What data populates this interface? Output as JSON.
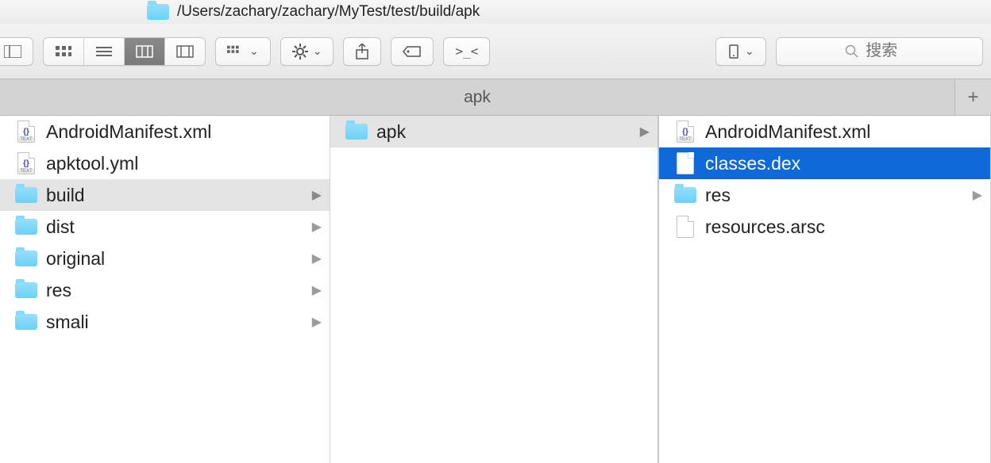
{
  "path": "/Users/zachary/zachary/MyTest/test/build/apk",
  "search": {
    "placeholder": "搜索"
  },
  "tab": {
    "label": "apk"
  },
  "columns": [
    {
      "items": [
        {
          "name": "AndroidManifest.xml",
          "kind": "xml",
          "arrow": false,
          "state": "none"
        },
        {
          "name": "apktool.yml",
          "kind": "xml",
          "arrow": false,
          "state": "none"
        },
        {
          "name": "build",
          "kind": "folder",
          "arrow": true,
          "state": "gray"
        },
        {
          "name": "dist",
          "kind": "folder",
          "arrow": true,
          "state": "none"
        },
        {
          "name": "original",
          "kind": "folder",
          "arrow": true,
          "state": "none"
        },
        {
          "name": "res",
          "kind": "folder",
          "arrow": true,
          "state": "none"
        },
        {
          "name": "smali",
          "kind": "folder",
          "arrow": true,
          "state": "none"
        }
      ]
    },
    {
      "items": [
        {
          "name": "apk",
          "kind": "folder",
          "arrow": true,
          "state": "gray"
        }
      ]
    },
    {
      "items": [
        {
          "name": "AndroidManifest.xml",
          "kind": "xml",
          "arrow": false,
          "state": "none"
        },
        {
          "name": "classes.dex",
          "kind": "file",
          "arrow": false,
          "state": "blue"
        },
        {
          "name": "res",
          "kind": "folder",
          "arrow": true,
          "state": "none"
        },
        {
          "name": "resources.arsc",
          "kind": "file",
          "arrow": false,
          "state": "none"
        }
      ]
    }
  ]
}
